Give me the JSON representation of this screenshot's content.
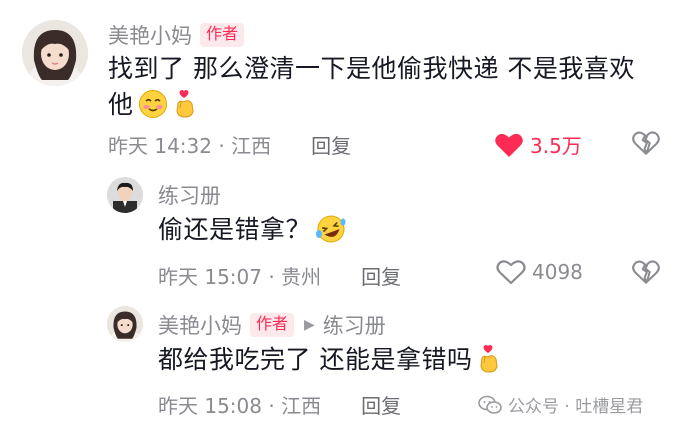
{
  "comments": [
    {
      "author": "美艳小妈",
      "badge": "作者",
      "text_line1": "找到了 那么澄清一下是他偷我快递 不是我喜欢",
      "text_line2": "他",
      "time_location": "昨天 14:32 · 江西",
      "reply_label": "回复",
      "likes": "3.5万",
      "liked": true
    },
    {
      "author": "练习册",
      "text_line1": "偷还是错拿？",
      "time_location": "昨天 15:07 · 贵州",
      "reply_label": "回复",
      "likes": "4098",
      "liked": false
    },
    {
      "author": "美艳小妈",
      "badge": "作者",
      "reply_to": "练习册",
      "text_line1": "都给我吃完了 还能是拿错吗",
      "time_location": "昨天 15:08 · 江西",
      "reply_label": "回复"
    }
  ],
  "watermark": "公众号 · 吐槽星君",
  "colors": {
    "accent": "#fe2c55",
    "muted": "#8a8b91",
    "text": "#161823"
  }
}
